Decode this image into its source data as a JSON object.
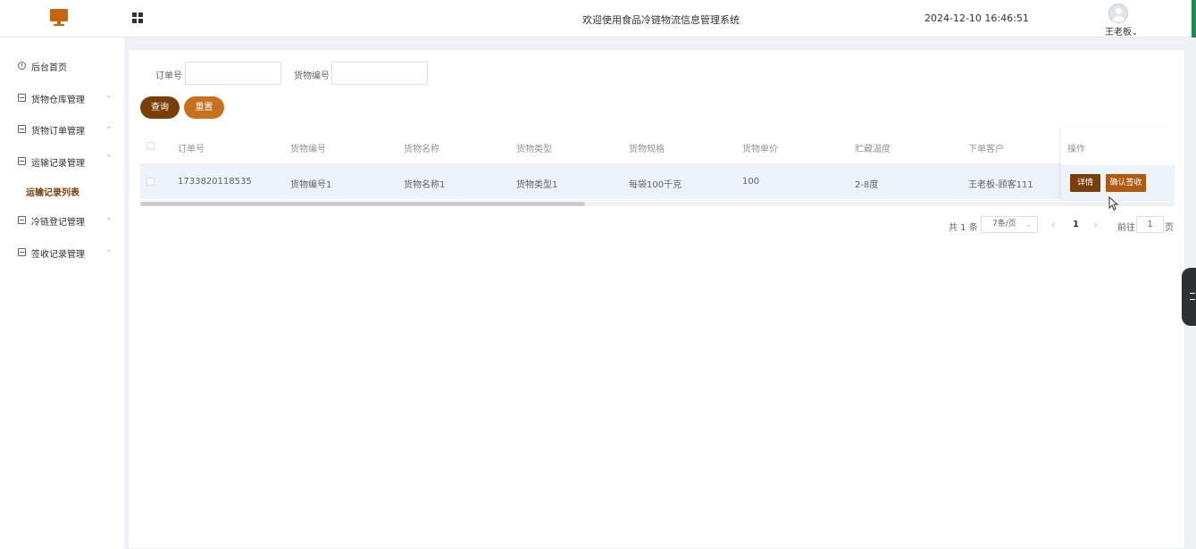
{
  "header": {
    "welcome": "欢迎使用食品冷链物流信息管理系统",
    "datetime": "2024-12-10 16:46:51",
    "user_name": "王老板",
    "user_chevron": "⌄",
    "brand_color": "#c7650f"
  },
  "sidebar": {
    "items": [
      {
        "label": "后台首页",
        "icon": "clock-icon"
      },
      {
        "label": "货物仓库管理",
        "icon": "box-icon",
        "chevron": "⌄"
      },
      {
        "label": "货物订单管理",
        "icon": "box-icon",
        "chevron": "⌄"
      },
      {
        "label": "运输记录管理",
        "icon": "box-icon",
        "chevron": "⌃"
      },
      {
        "label": "冷链登记管理",
        "icon": "box-icon",
        "chevron": "⌄"
      },
      {
        "label": "签收记录管理",
        "icon": "box-icon",
        "chevron": "⌄"
      }
    ],
    "active_submenu": "运输记录列表"
  },
  "search": {
    "order_label": "订单号",
    "order_value": "",
    "goods_label": "货物编号",
    "goods_value": "",
    "query_label": "查询",
    "reset_label": "重置"
  },
  "table": {
    "headers": [
      "订单号",
      "货物编号",
      "货物名称",
      "货物类型",
      "货物规格",
      "货物单价",
      "贮藏温度",
      "下单客户",
      "操作"
    ],
    "rows": [
      {
        "order_no": "1733820118535",
        "goods_no": "货物编号1",
        "goods_name": "货物名称1",
        "goods_type": "货物类型1",
        "spec": "每袋100千克",
        "price": "100",
        "temp": "2-8度",
        "customer": "王老板-顾客111",
        "detail_label": "详情",
        "confirm_label": "确认签收"
      }
    ]
  },
  "pagination": {
    "total": "共 1 条",
    "page_size": "7条/页",
    "prev": "‹",
    "current": "1",
    "next": "›",
    "goto_label": "前往",
    "goto_value": "1",
    "page_unit": "页"
  },
  "colors": {
    "primary_dark": "#7a3f08",
    "primary_light": "#c7711c",
    "confirm": "#b05a0f",
    "row_highlight": "#edf3fb"
  }
}
